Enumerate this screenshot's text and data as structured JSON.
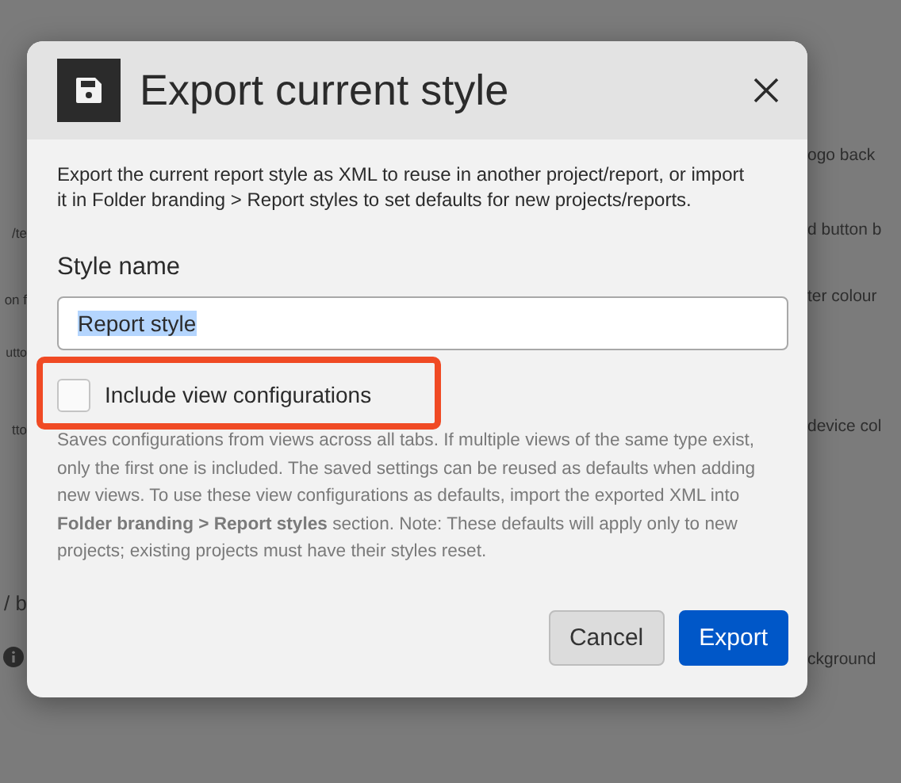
{
  "background": {
    "left": [
      {
        "text": "/te",
        "kind": "text"
      },
      {
        "text": "on f",
        "kind": "text"
      },
      {
        "text": "utto",
        "kind": "small"
      },
      {
        "text": "tto",
        "kind": "text"
      },
      {
        "text": "/ b",
        "kind": "heading"
      },
      {
        "kind": "info"
      }
    ],
    "right": [
      {
        "text": "ogo back"
      },
      {
        "text": "d button b"
      },
      {
        "text": "ter colour"
      },
      {
        "text": "device col"
      },
      {
        "text": "ckground"
      }
    ]
  },
  "dialog": {
    "title": "Export current style",
    "description": "Export the current report style as XML to reuse in another project/report, or import it in Folder branding > Report styles to set defaults for new projects/reports.",
    "field": {
      "label": "Style name",
      "value": "Report style",
      "text_selected": true
    },
    "checkbox": {
      "label": "Include view configurations",
      "checked": false,
      "highlighted": true
    },
    "help": "Saves configurations from views across all tabs. If multiple views of the same type exist, only the first one is included. The saved settings can be reused as defaults when adding new views. To use these view configurations as defaults, import the exported XML into **Folder branding > Report styles** section. Note: These defaults will apply only to new projects; existing projects must have their styles reset.",
    "buttons": [
      {
        "label": "Cancel",
        "kind": "secondary"
      },
      {
        "label": "Export",
        "kind": "primary"
      }
    ]
  }
}
